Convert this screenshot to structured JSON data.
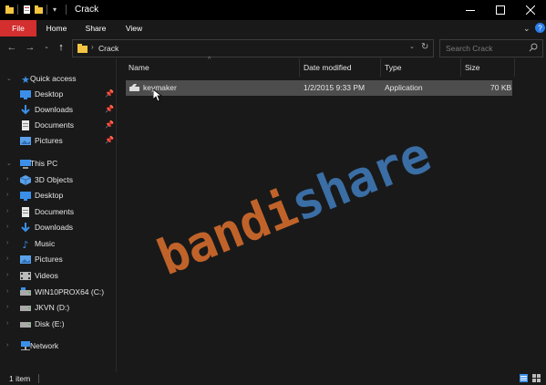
{
  "window": {
    "title": "Crack",
    "controls": [
      "minimize",
      "maximize",
      "close"
    ]
  },
  "ribbon": {
    "tabs": [
      "File",
      "Home",
      "Share",
      "View"
    ],
    "active_tab": "File",
    "accent_color": "#d32f2f"
  },
  "address": {
    "path": [
      "Crack"
    ],
    "search_placeholder": "Search Crack"
  },
  "nav_pane": {
    "quick_access": {
      "label": "Quick access",
      "items": [
        {
          "label": "Desktop",
          "icon": "desktop-icon",
          "pinned": true
        },
        {
          "label": "Downloads",
          "icon": "downloads-icon",
          "pinned": true
        },
        {
          "label": "Documents",
          "icon": "documents-icon",
          "pinned": true
        },
        {
          "label": "Pictures",
          "icon": "pictures-icon",
          "pinned": true
        }
      ]
    },
    "this_pc": {
      "label": "This PC",
      "items": [
        {
          "label": "3D Objects",
          "icon": "3d-objects-icon"
        },
        {
          "label": "Desktop",
          "icon": "desktop-icon"
        },
        {
          "label": "Documents",
          "icon": "documents-icon"
        },
        {
          "label": "Downloads",
          "icon": "downloads-icon"
        },
        {
          "label": "Music",
          "icon": "music-icon"
        },
        {
          "label": "Pictures",
          "icon": "pictures-icon"
        },
        {
          "label": "Videos",
          "icon": "videos-icon"
        },
        {
          "label": "WIN10PROX64 (C:)",
          "icon": "drive-icon"
        },
        {
          "label": "JKVN (D:)",
          "icon": "drive-icon"
        },
        {
          "label": "Disk (E:)",
          "icon": "drive-icon"
        }
      ]
    },
    "network": {
      "label": "Network",
      "icon": "network-icon"
    }
  },
  "file_list": {
    "columns": [
      "Name",
      "Date modified",
      "Type",
      "Size"
    ],
    "rows": [
      {
        "name": "keymaker",
        "date_modified": "1/2/2015 9:33 PM",
        "type": "Application",
        "size": "70 KB",
        "selected": true
      }
    ]
  },
  "watermark": {
    "part1": "bandi",
    "part2": "share",
    "color1": "#c0632a",
    "color2": "#3a6ea5"
  },
  "status_bar": {
    "item_count": "1 item"
  }
}
